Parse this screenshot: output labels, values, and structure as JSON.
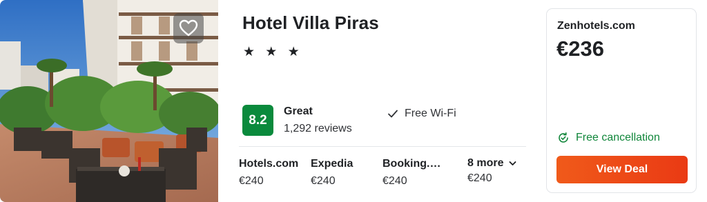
{
  "hotel": {
    "name": "Hotel Villa Piras",
    "stars": "★ ★ ★",
    "star_count": 3
  },
  "rating": {
    "score": "8.2",
    "label": "Great",
    "reviews": "1,292 reviews"
  },
  "amenities": [
    {
      "icon": "check-icon",
      "label": "Free Wi-Fi"
    }
  ],
  "providers": [
    {
      "name": "Hotels.com",
      "price": "€240"
    },
    {
      "name": "Expedia",
      "price": "€240"
    },
    {
      "name": "Booking.…",
      "price": "€240"
    }
  ],
  "more_providers": {
    "label": "8 more",
    "price": "€240",
    "icon": "chevron-down-icon"
  },
  "deal": {
    "provider": "Zenhotels.com",
    "price": "€236",
    "cancellation": "Free cancellation",
    "cancellation_icon": "refund-icon",
    "button_label": "View Deal"
  },
  "favorite_icon": "heart-icon",
  "colors": {
    "score_bg": "#0a8a3c",
    "cancel_text": "#10863a",
    "deal_button": "#ec4616"
  }
}
